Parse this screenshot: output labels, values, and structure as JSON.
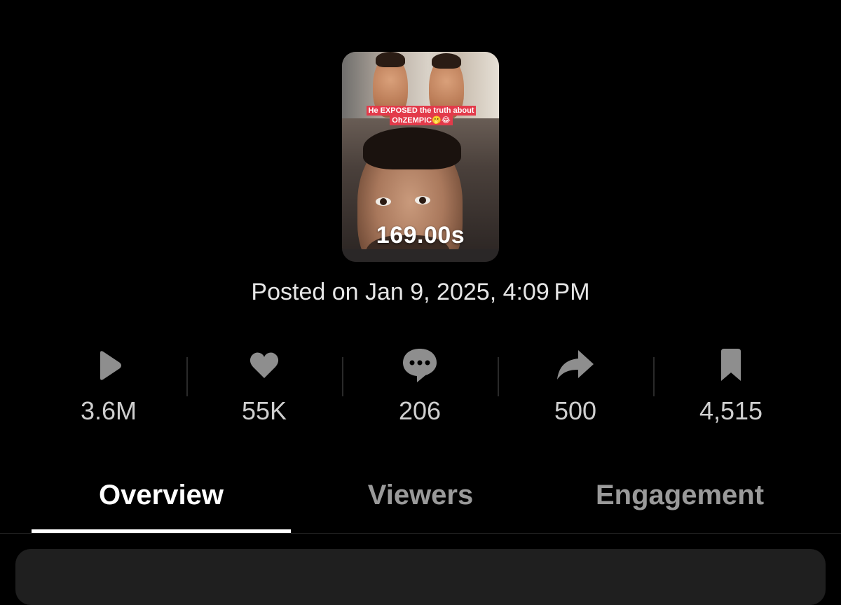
{
  "video": {
    "caption_line1": "He EXPOSED the truth about",
    "caption_line2": "OhZEMPIC🫢😂",
    "duration": "169.00s"
  },
  "posted": "Posted on Jan 9, 2025, 4:09 PM",
  "stats": [
    {
      "icon": "play-icon",
      "value": "3.6M"
    },
    {
      "icon": "heart-icon",
      "value": "55K"
    },
    {
      "icon": "comment-icon",
      "value": "206"
    },
    {
      "icon": "share-icon",
      "value": "500"
    },
    {
      "icon": "bookmark-icon",
      "value": "4,515"
    }
  ],
  "tabs": [
    {
      "label": "Overview",
      "active": true
    },
    {
      "label": "Viewers",
      "active": false
    },
    {
      "label": "Engagement",
      "active": false
    }
  ],
  "colors": {
    "background": "#000000",
    "icon": "#8e8e8e",
    "stat_text": "#cfcfcf",
    "tab_active": "#ffffff",
    "tab_inactive": "#9a9a9a",
    "caption_bg": "#e33a4a",
    "card": "#1f1f1f"
  }
}
